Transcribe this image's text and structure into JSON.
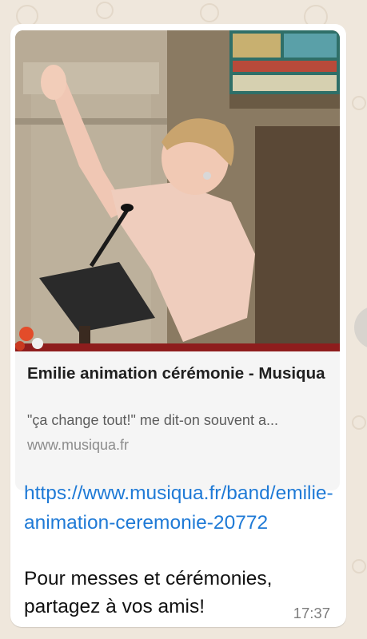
{
  "message": {
    "link_preview": {
      "title": "Emilie animation cérémonie - Musiqua",
      "description": "\"ça change tout!\" me dit-on souvent a...",
      "domain": "www.musiqua.fr",
      "image_subject": "woman-conducting-singing-in-church"
    },
    "link_url": "https://www.musiqua.fr/band/emilie-animation-ceremonie-20772",
    "text": "Pour messes et cérémonies, partagez à vos amis!",
    "time": "17:37"
  },
  "colors": {
    "bubble": "#ffffff",
    "wallpaper": "#efe7dc",
    "link": "#1f7ad6",
    "preview_bg": "#f5f5f5"
  },
  "icons": [
    "forward-icon"
  ]
}
